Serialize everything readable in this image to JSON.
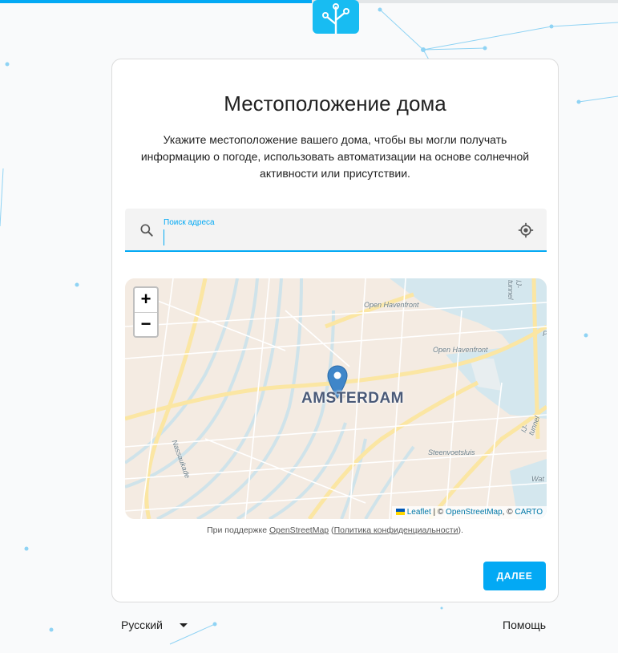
{
  "header": {
    "progress_percent": 50,
    "accent": "#03a9f4"
  },
  "card": {
    "title": "Местоположение дома",
    "description": "Укажите местоположение вашего дома, чтобы вы могли получать информацию о погоде, использовать автоматизации на основе солнечной активности или присутствии."
  },
  "search": {
    "label": "Поиск адреса",
    "value": ""
  },
  "map": {
    "zoom_in": "+",
    "zoom_out": "−",
    "city": "AMSTERDAM",
    "streets": [
      "Open Havenfront",
      "Open Havenfront",
      "Nassaukade",
      "Steenvoetsluis",
      "IJ-tunnel",
      "IJ-tunnel",
      "Wat",
      "P"
    ],
    "attribution": {
      "leaflet": "Leaflet",
      "sep1": " | © ",
      "osm": "OpenStreetMap",
      "sep2": ", © ",
      "carto": "CARTO"
    }
  },
  "osm_note": {
    "prefix": "При поддержке ",
    "osm_link": "OpenStreetMap",
    "open_paren": " (",
    "privacy_link": "Политика конфиденциальности",
    "close": ")."
  },
  "next_button": "ДАЛЕЕ",
  "footer": {
    "language": "Русский",
    "help": "Помощь"
  }
}
